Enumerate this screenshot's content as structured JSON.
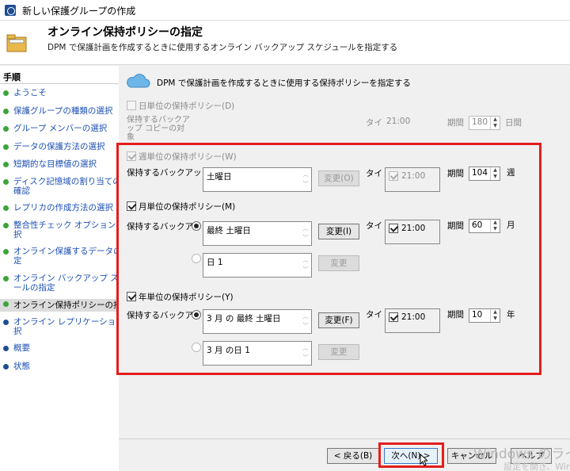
{
  "window": {
    "title": "新しい保護グループの作成"
  },
  "header": {
    "title": "オンライン保持ポリシーの指定",
    "subtitle": "DPM で保護計画を作成するときに使用するオンライン バックアップ スケジュールを指定する"
  },
  "sidebar": {
    "title": "手順",
    "items": [
      {
        "label": "ようこそ"
      },
      {
        "label": "保護グループの種類の選択"
      },
      {
        "label": "グループ メンバーの選択"
      },
      {
        "label": "データの保護方法の選択"
      },
      {
        "label": "短期的な目標値の選択"
      },
      {
        "label": "ディスク記憶域の割り当ての",
        "label2": "確認"
      },
      {
        "label": "レプリカの作成方法の選択"
      },
      {
        "label": "整合性チェック オプションの選",
        "label2": "択"
      },
      {
        "label": "オンライン保護するデータの指",
        "label2": "定"
      },
      {
        "label": "オンライン バックアップ スケジュ",
        "label2": "ールの指定"
      },
      {
        "label": "オンライン保持ポリシーの指定"
      },
      {
        "label": "オンライン レプリケーションの選",
        "label2": "択"
      },
      {
        "label": "概要"
      },
      {
        "label": "状態"
      }
    ]
  },
  "main": {
    "description": "DPM で保護計画を作成するときに使用する保持ポリシーを指定する",
    "daily": {
      "label": "日単位の保持ポリシー(D)",
      "retain_label_1": "保持するバックア",
      "retain_label_2": "ップ コピーの対",
      "retain_label_3": "象",
      "time_label": "タイ",
      "time_value": "21:00",
      "period_label": "期間",
      "period_value": "180",
      "unit": "日間"
    },
    "weekly": {
      "label": "週単位の保持ポリシー(W)",
      "retain_label": "保持するバックアッ",
      "selection": "土曜日",
      "change_button": "変更(O)",
      "time_label": "タイ",
      "time_value": "21:00",
      "period_label": "期間",
      "period_value": "104",
      "unit": "週"
    },
    "monthly": {
      "label": "月単位の保持ポリシー(M)",
      "retain_label": "保持するバックアッ",
      "selection_1": "最終 土曜日",
      "change_button_1": "変更(I)",
      "selection_2": "日 1",
      "change_button_2": "変更",
      "time_label": "タイ",
      "time_value": "21:00",
      "period_label": "期間",
      "period_value": "60",
      "unit": "月"
    },
    "yearly": {
      "label": "年単位の保持ポリシー(Y)",
      "retain_label": "保持するバックアッ",
      "selection_1": "3 月 の 最終 土曜日",
      "change_button_1": "変更(F)",
      "selection_2": "3 月 の日 1",
      "change_button_2": "変更",
      "time_label": "タイ",
      "time_value": "21:00",
      "period_label": "期間",
      "period_value": "10",
      "unit": "年"
    }
  },
  "footer": {
    "back": "< 戻る(B)",
    "next": "次へ(N) >",
    "cancel": "キャンセル",
    "help": "ヘルプ",
    "watermark_1": "Windows のライ",
    "watermark_2": "設定を開き、Windo"
  },
  "colors": {
    "highlight": "#e41d1d",
    "link": "#1a4fb4",
    "step_done": "#3aa53a"
  }
}
